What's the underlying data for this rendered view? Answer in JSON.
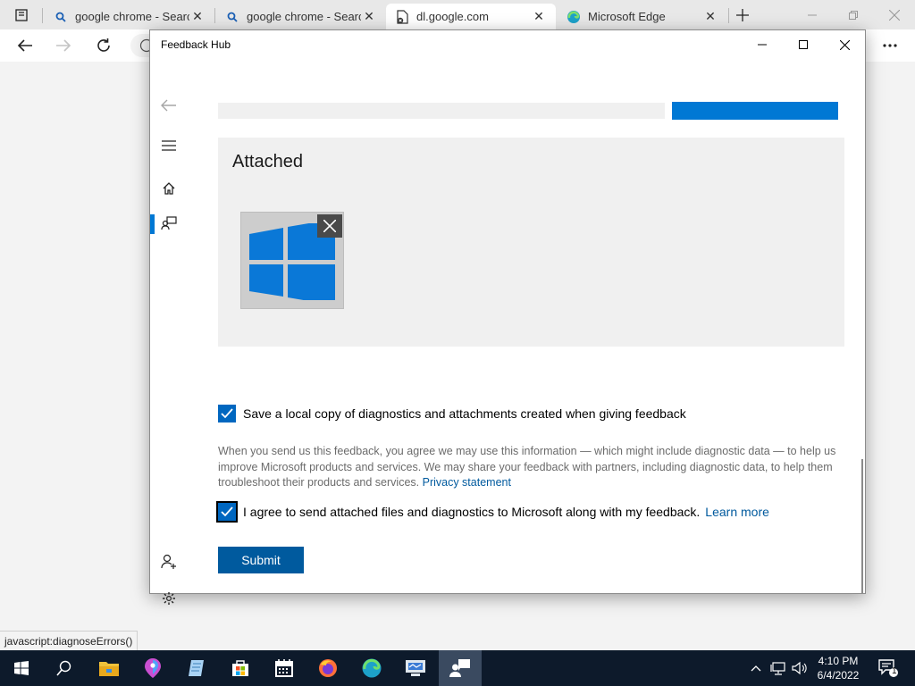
{
  "browser": {
    "tabs": [
      {
        "title": "google chrome - Search",
        "icon": "search-icon"
      },
      {
        "title": "google chrome - Search",
        "icon": "search-icon"
      },
      {
        "title": "dl.google.com",
        "icon": "page-error-icon"
      },
      {
        "title": "Microsoft Edge",
        "icon": "edge-icon"
      }
    ],
    "status_url": "javascript:diagnoseErrors()"
  },
  "feedback_hub": {
    "window_title": "Feedback Hub",
    "upload_progress": 0.27,
    "attached_title": "Attached",
    "attachment_icon": "windows-logo-icon",
    "save_copy_label": "Save a local copy of diagnostics and attachments created when giving feedback",
    "save_copy_checked": true,
    "legal_text": "When you send us this feedback, you agree we may use this information — which might include diagnostic data — to help us improve Microsoft products and services. We may share your feedback with partners, including diagnostic data, to help them troubleshoot their products and services.",
    "privacy_link": "Privacy statement",
    "agree_label": "I agree to send attached files and diagnostics to Microsoft along with my feedback.",
    "agree_checked": true,
    "learn_more_link": "Learn more",
    "submit_label": "Submit"
  },
  "taskbar": {
    "time": "4:10 PM",
    "date": "6/4/2022",
    "notification_count": "1",
    "pinned": [
      "file-explorer-icon",
      "maps-icon",
      "notepad-icon",
      "store-icon",
      "calendar-icon",
      "firefox-icon",
      "edge-icon",
      "remote-app-icon",
      "feedback-hub-icon"
    ]
  },
  "colors": {
    "accent": "#0078d4",
    "submit_bg": "#005a9e",
    "link": "#005a9e",
    "taskbar_bg": "#0d1a2b"
  }
}
